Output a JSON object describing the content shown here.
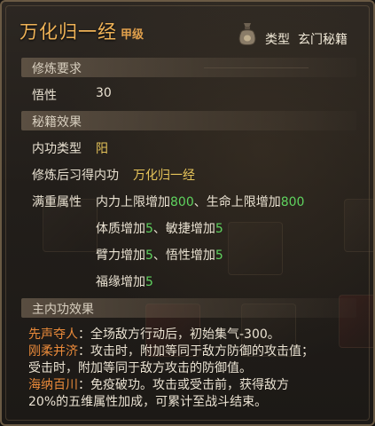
{
  "title": "万化归一经",
  "grade": "甲级",
  "type_label": "类型",
  "type_value": "玄门秘籍",
  "sections": {
    "requirements": "修炼要求",
    "effects": "秘籍效果",
    "main_effect": "主内功效果"
  },
  "requirement": {
    "label": "悟性",
    "value": "30"
  },
  "effects": {
    "neigong_type_label": "内功类型",
    "neigong_type_value": "阳",
    "learned_label": "修炼后习得内功",
    "learned_value": "万化归一经",
    "full_attr_label": "满重属性"
  },
  "attributes": [
    [
      {
        "text": "内力上限增加",
        "num": "800"
      },
      {
        "text": "、生命上限增加",
        "num": "800"
      }
    ],
    [
      {
        "text": "体质增加",
        "num": "5"
      },
      {
        "text": "、敏捷增加",
        "num": "5"
      }
    ],
    [
      {
        "text": "臂力增加",
        "num": "5"
      },
      {
        "text": "、悟性增加",
        "num": "5"
      }
    ],
    [
      {
        "text": "福缘增加",
        "num": "5"
      }
    ]
  ],
  "main_effects": [
    {
      "name": "先声夺人",
      "desc": "：全场敌方行动后，初始集气-300。"
    },
    {
      "name": "刚柔并济",
      "desc": "：攻击时，附加等同于敌方防御的攻击值；"
    },
    {
      "name": "",
      "desc": "受击时，附加等同于敌方攻击的防御值。"
    },
    {
      "name": "海纳百川",
      "desc": "：免疫破功。攻击或受击前，获得敌方"
    },
    {
      "name": "",
      "desc": "20%的五维属性加成，可累计至战斗结束。"
    }
  ],
  "colors": {
    "title": "#f0b357",
    "yellow_value": "#e6c45a",
    "green_number": "#5fd35f",
    "effect_name": "#ea8a3a"
  },
  "icons": [
    "money-bag-icon"
  ]
}
